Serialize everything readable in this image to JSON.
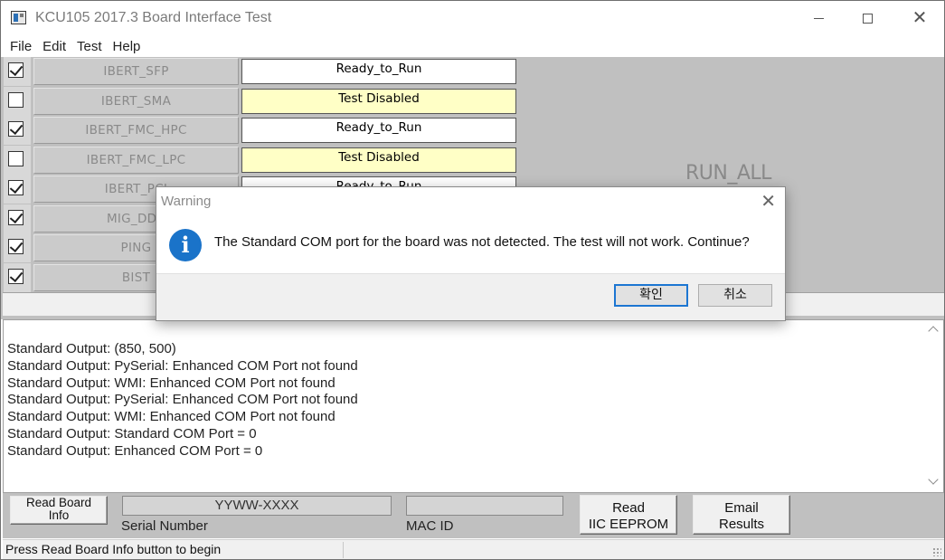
{
  "window": {
    "title": "KCU105 2017.3 Board Interface Test"
  },
  "menu": [
    "File",
    "Edit",
    "Test",
    "Help"
  ],
  "tests": [
    {
      "name": "IBERT_SFP",
      "checked": true,
      "status": "Ready_to_Run"
    },
    {
      "name": "IBERT_SMA",
      "checked": false,
      "status": "Test Disabled"
    },
    {
      "name": "IBERT_FMC_HPC",
      "checked": true,
      "status": "Ready_to_Run"
    },
    {
      "name": "IBERT_FMC_LPC",
      "checked": false,
      "status": "Test Disabled"
    },
    {
      "name": "IBERT_PCI",
      "checked": true,
      "status": "Ready_to_Run"
    },
    {
      "name": "MIG_DDR",
      "checked": true,
      "status": ""
    },
    {
      "name": "PING",
      "checked": true,
      "status": ""
    },
    {
      "name": "BIST",
      "checked": true,
      "status": ""
    }
  ],
  "run_all_label": "RUN_ALL",
  "log": [
    "Standard Output: (850, 500)",
    "Standard Output: PySerial: Enhanced COM Port not found",
    "Standard Output: WMI: Enhanced COM Port not found",
    "Standard Output: PySerial: Enhanced COM Port not found",
    "Standard Output: WMI: Enhanced COM Port not found",
    "Standard Output: Standard COM Port = 0",
    "Standard Output: Enhanced COM Port = 0"
  ],
  "bottom": {
    "read_board_label_1": "Read Board",
    "read_board_label_2": "Info",
    "serial_value": "YYWW-XXXX",
    "serial_label": "Serial Number",
    "mac_value": "",
    "mac_label": "MAC ID",
    "read_iic_label_1": "Read",
    "read_iic_label_2": "IIC EEPROM",
    "email_label_1": "Email",
    "email_label_2": "Results"
  },
  "status_bar": "Press Read Board Info button to begin",
  "dialog": {
    "title": "Warning",
    "message": "The Standard COM port for the board was not detected. The test will not work. Continue?",
    "ok_label": "확인",
    "cancel_label": "취소"
  },
  "colors": {
    "disabled_status_bg": "#ffffc6",
    "panel_grey": "#c0c0c0",
    "info_icon": "#1a73c9",
    "default_button_border": "#1c76d2"
  }
}
